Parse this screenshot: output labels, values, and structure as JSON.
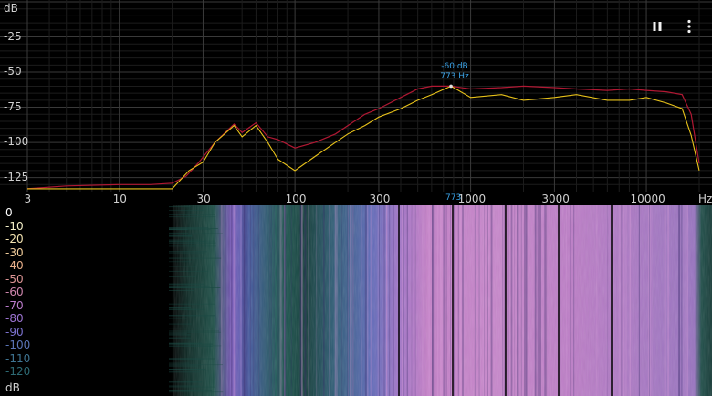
{
  "colors": {
    "background": "#000000",
    "grid": "#2a2a2a",
    "spectrum_peak": "#b01833",
    "spectrum_live": "#e8c21a",
    "accent_text": "#3aa3e8",
    "axis_text": "#cfcfcf"
  },
  "spectrum": {
    "y_unit": "dB",
    "y_ticks": [
      "-25",
      "-50",
      "-75",
      "-100",
      "-125"
    ],
    "x_ticks": [
      "3",
      "10",
      "30",
      "100",
      "300",
      "1000",
      "3000",
      "10000"
    ],
    "x_unit": "Hz",
    "peak_label_db": "-60 dB",
    "peak_label_hz": "773 Hz",
    "cursor_freq": "773",
    "pause_icon": "pause-icon",
    "menu_icon": "more-vert-icon"
  },
  "spectrogram": {
    "y_ticks": [
      {
        "label": "0",
        "color": "#ffffff"
      },
      {
        "label": "-10",
        "color": "#f4f0c8"
      },
      {
        "label": "-20",
        "color": "#f3e3b0"
      },
      {
        "label": "-30",
        "color": "#f1cc9a"
      },
      {
        "label": "-40",
        "color": "#eab08a"
      },
      {
        "label": "-50",
        "color": "#dd9494"
      },
      {
        "label": "-60",
        "color": "#cf86ae"
      },
      {
        "label": "-70",
        "color": "#bb7ccc"
      },
      {
        "label": "-80",
        "color": "#9c74d2"
      },
      {
        "label": "-90",
        "color": "#7c72cf"
      },
      {
        "label": "-100",
        "color": "#5b75b8"
      },
      {
        "label": "-110",
        "color": "#3f7593"
      },
      {
        "label": "-120",
        "color": "#2d6a74"
      }
    ],
    "y_unit": "dB"
  },
  "chart_data": {
    "type": "line",
    "x_scale": "log",
    "xlim": [
      3,
      20000
    ],
    "ylim": [
      -135,
      0
    ],
    "grid": true,
    "ylabel": "dB",
    "xlabel": "Hz",
    "series": [
      {
        "x": [
          3,
          5,
          10,
          15,
          20,
          24,
          28,
          35,
          45,
          50,
          60,
          70,
          80,
          100,
          130,
          170,
          200,
          250,
          300,
          400,
          500,
          600,
          773,
          1000,
          1500,
          2000,
          3000,
          4000,
          6000,
          8000,
          10000,
          13000,
          16000,
          18000,
          20000
        ],
        "y": [
          -133,
          -131,
          -130,
          -130,
          -129,
          -124,
          -115,
          -100,
          -87,
          -93,
          -86,
          -96,
          -98,
          -104,
          -100,
          -94,
          -88,
          -80,
          -76,
          -68,
          -62,
          -60,
          -60,
          -62,
          -61,
          -60,
          -61,
          -62,
          -63,
          -62,
          -63,
          -64,
          -66,
          -80,
          -115
        ]
      },
      {
        "x": [
          3,
          5,
          10,
          15,
          18,
          20,
          25,
          30,
          35,
          45,
          50,
          60,
          70,
          80,
          100,
          130,
          170,
          200,
          250,
          300,
          400,
          500,
          600,
          773,
          1000,
          1500,
          2000,
          3000,
          4000,
          6000,
          8000,
          10000,
          13000,
          16000,
          18000,
          20000
        ],
        "y": [
          -133,
          -133,
          -133,
          -133,
          -133,
          -133,
          -120,
          -114,
          -100,
          -88,
          -96,
          -88,
          -100,
          -112,
          -120,
          -110,
          -100,
          -94,
          -88,
          -82,
          -76,
          -70,
          -66,
          -60,
          -68,
          -66,
          -70,
          -68,
          -66,
          -70,
          -70,
          -68,
          -72,
          -76,
          -95,
          -120
        ]
      }
    ]
  }
}
